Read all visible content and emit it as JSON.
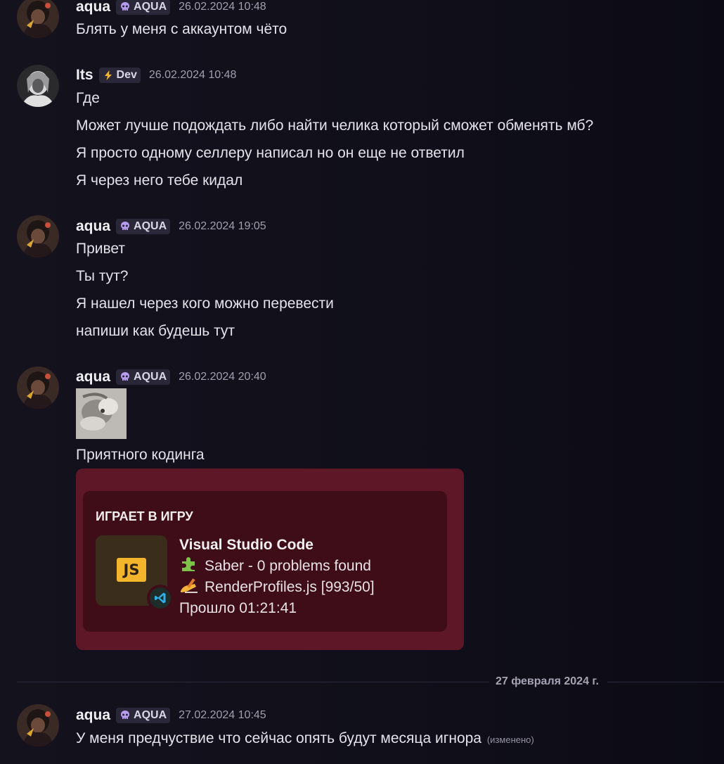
{
  "messages": [
    {
      "author": "aqua",
      "tag": {
        "icon": "skull-icon",
        "label": "AQUA"
      },
      "timestamp": "26.02.2024 10:48",
      "lines": [
        "Блять у меня с аккаунтом чёто"
      ]
    },
    {
      "author": "Its",
      "tag": {
        "icon": "lightning-icon",
        "label": "Dev"
      },
      "timestamp": "26.02.2024 10:48",
      "lines": [
        "Где",
        "Может лучше подождать либо найти челика который сможет обменять мб?",
        "Я просто одному селлеру написал но он еще не ответил",
        "Я через него тебе кидал"
      ]
    },
    {
      "author": "aqua",
      "tag": {
        "icon": "skull-icon",
        "label": "AQUA"
      },
      "timestamp": "26.02.2024 19:05",
      "lines": [
        "Привет",
        "Ты тут?",
        "Я нашел через кого можно перевести",
        "напиши как будешь тут"
      ]
    },
    {
      "author": "aqua",
      "tag": {
        "icon": "skull-icon",
        "label": "AQUA"
      },
      "timestamp": "26.02.2024 20:40",
      "lines": [
        "Приятного кодинга"
      ],
      "activity": {
        "heading": "ИГРАЕТ В ИГРУ",
        "app_name": "Visual Studio Code",
        "app_icon_text": "JS",
        "details": [
          {
            "icon": "puzzle-piece-icon",
            "text": "Saber - 0 problems found"
          },
          {
            "icon": "writing-hand-icon",
            "text": "RenderProfiles.js [993/50]"
          }
        ],
        "elapsed": "Прошло 01:21:41"
      }
    },
    {
      "author": "aqua",
      "tag": {
        "icon": "skull-icon",
        "label": "AQUA"
      },
      "timestamp": "27.02.2024 10:45",
      "lines": [
        "У меня предчуствие что сейчас опять будут месяца игнора"
      ],
      "edited": "(изменено)"
    }
  ],
  "date_divider": "27 февраля 2024 г.",
  "colors": {
    "background": "#100f1a",
    "tag_background": "#2a2838",
    "card_outer": "#5e1727",
    "card_inner": "#3e0d18",
    "js_badge": "#f2b52b"
  }
}
